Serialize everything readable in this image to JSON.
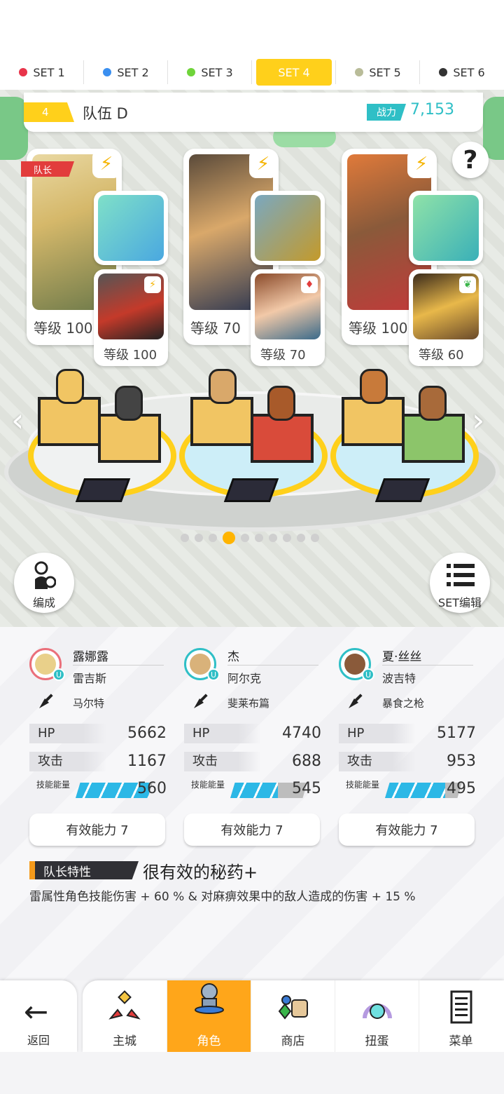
{
  "sets": [
    {
      "label": "SET 1",
      "color": "#e8344a"
    },
    {
      "label": "SET 2",
      "color": "#3a8ff0"
    },
    {
      "label": "SET 3",
      "color": "#6fd43a"
    },
    {
      "label": "SET 4",
      "color": "#ffffff",
      "active": true
    },
    {
      "label": "SET 5",
      "color": "#b9bc99"
    },
    {
      "label": "SET 6",
      "color": "#333333"
    }
  ],
  "team": {
    "number": "4",
    "name": "队伍 D",
    "power_label": "战力",
    "power_value": "7,153"
  },
  "formation": {
    "leader_label": "队长",
    "slots": [
      {
        "hero_level": "等级 100",
        "sub_level": "等级 100"
      },
      {
        "hero_level": "等级 70",
        "sub_level": "等级 70"
      },
      {
        "hero_level": "等级 100",
        "sub_level": "等级 60"
      }
    ]
  },
  "buttons": {
    "edit": "编成",
    "set_edit": "SET编辑",
    "help": "?"
  },
  "heroes": [
    {
      "name": "露娜露",
      "sub": "雷吉斯",
      "weapon": "马尔特",
      "hp_label": "HP",
      "hp": "5662",
      "atk_label": "攻击",
      "atk": "1167",
      "energy_label": "技能能量",
      "energy": "560",
      "energy_fill": 0.95,
      "effective": "有效能力 7"
    },
    {
      "name": "杰",
      "sub": "阿尔克",
      "weapon": "斐莱布篇",
      "hp_label": "HP",
      "hp": "4740",
      "atk_label": "攻击",
      "atk": "688",
      "energy_label": "技能能量",
      "energy": "545",
      "energy_fill": 0.62,
      "effective": "有效能力 7"
    },
    {
      "name": "夏·丝丝",
      "sub": "波吉特",
      "weapon": "暴食之枪",
      "hp_label": "HP",
      "hp": "5177",
      "atk_label": "攻击",
      "atk": "953",
      "energy_label": "技能能量",
      "energy": "495",
      "energy_fill": 0.78,
      "effective": "有效能力 7"
    }
  ],
  "leader_skill": {
    "tag": "队长特性",
    "title": "很有效的秘药+",
    "desc": "雷属性角色技能伤害 + 60 % & 对麻痹效果中的敌人造成的伤害 + 15 %"
  },
  "page_dots": {
    "total": 10,
    "active": 4
  },
  "nav": {
    "back": "返回",
    "items": [
      {
        "label": "主城",
        "icon": "castle-icon"
      },
      {
        "label": "角色",
        "icon": "character-icon",
        "active": true
      },
      {
        "label": "商店",
        "icon": "shop-icon"
      },
      {
        "label": "扭蛋",
        "icon": "gacha-icon"
      },
      {
        "label": "菜单",
        "icon": "menu-icon"
      }
    ]
  }
}
